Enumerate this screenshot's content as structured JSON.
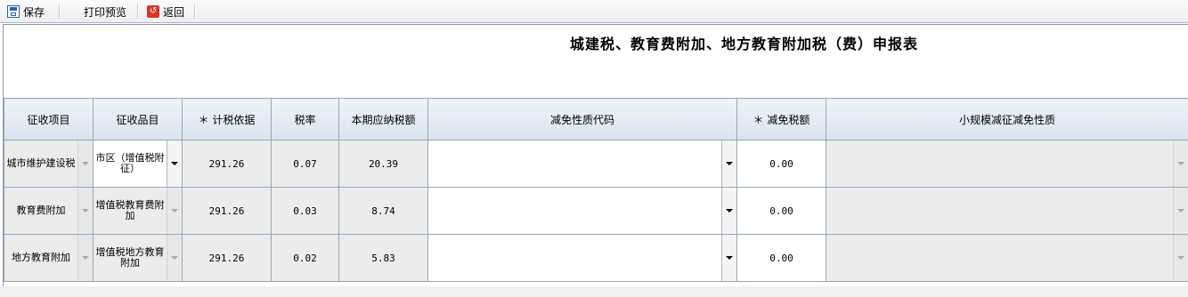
{
  "toolbar": {
    "save_label": "保存",
    "print_label": "打印预览",
    "back_label": "返回"
  },
  "form": {
    "title": "城建税、教育费附加、地方教育附加税（费）申报表",
    "headers": [
      "征收项目",
      "征收品目",
      "＊ 计税依据",
      "税率",
      "本期应纳税额",
      "减免性质代码",
      "＊ 减免税额",
      "小规模减征减免性质"
    ],
    "rows": [
      {
        "item": "城市维护建设税",
        "category": "市区（增值税附征）",
        "basis": "291.26",
        "rate": "0.07",
        "tax": "20.39",
        "code": "",
        "relief": "0.00",
        "small": ""
      },
      {
        "item": "教育费附加",
        "category": "增值税教育费附加",
        "basis": "291.26",
        "rate": "0.03",
        "tax": "8.74",
        "code": "",
        "relief": "0.00",
        "small": ""
      },
      {
        "item": "地方教育附加",
        "category": "增值税地方教育附加",
        "basis": "291.26",
        "rate": "0.02",
        "tax": "5.83",
        "code": "",
        "relief": "0.00",
        "small": ""
      }
    ]
  },
  "icons": {
    "save": "save-icon",
    "back": "back-icon",
    "dropdown": "chevron-down-icon"
  }
}
